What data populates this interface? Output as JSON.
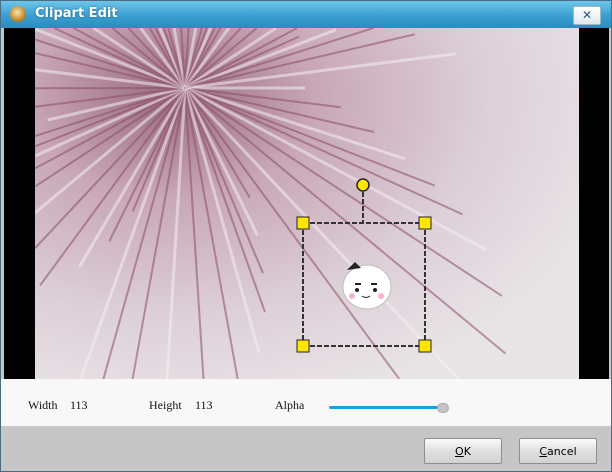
{
  "window": {
    "title": "Clipart Edit",
    "close_label": "✕"
  },
  "controls": {
    "width_label": "Width",
    "width_value": "113",
    "height_label": "Height",
    "height_value": "113",
    "alpha_label": "Alpha",
    "alpha_percent": 95
  },
  "buttons": {
    "ok_key": "O",
    "ok_rest": "K",
    "cancel_key": "C",
    "cancel_rest": "ancel"
  },
  "colors": {
    "titlebar": "#3a9fd0",
    "slider": "#1a9ee6",
    "handle": "#ffe600"
  }
}
